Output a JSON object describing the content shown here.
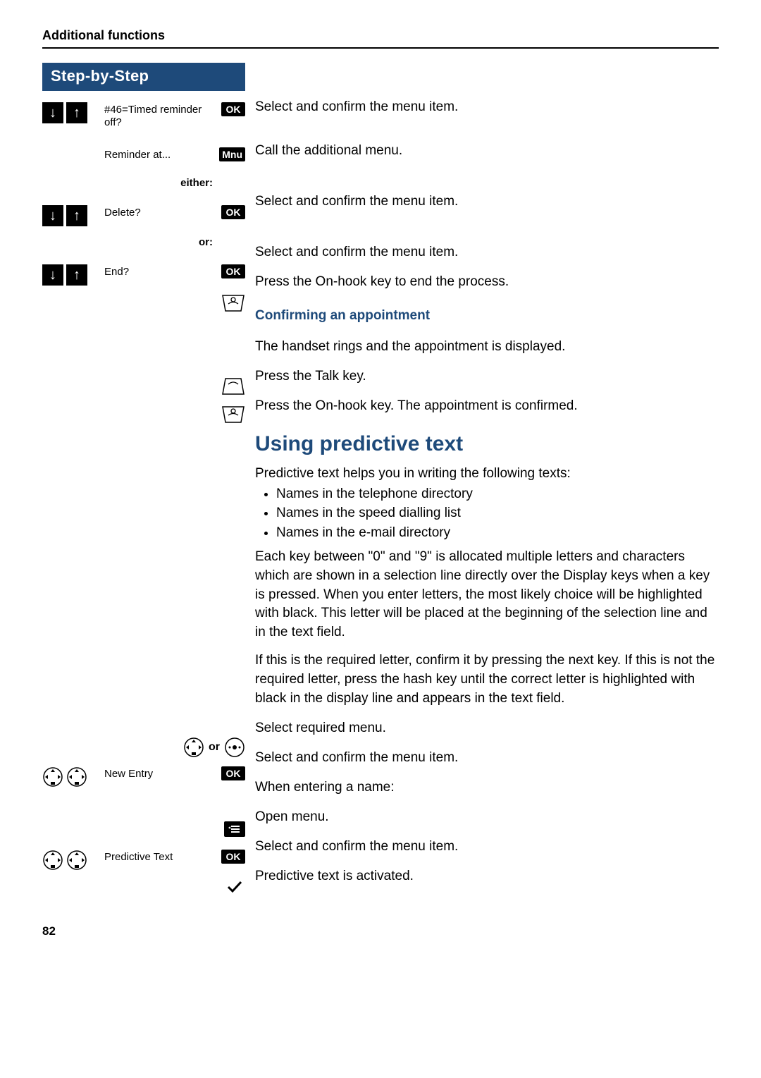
{
  "header": "Additional functions",
  "step_header": "Step-by-Step",
  "page_number": "82",
  "left": {
    "row1_label": "#46=Timed reminder off?",
    "row1_badge": "OK",
    "row2_label": "Reminder at...",
    "row2_badge": "Mnu",
    "either": "either:",
    "row3_label": "Delete?",
    "row3_badge": "OK",
    "or": "or:",
    "row4_label": "End?",
    "row4_badge": "OK",
    "nav_or": "or",
    "new_entry_label": "New Entry",
    "new_entry_badge": "OK",
    "predictive_label": "Predictive Text",
    "predictive_badge": "OK"
  },
  "right": {
    "r1": "Select and confirm the menu item.",
    "r2": "Call the additional menu.",
    "r3": "Select and confirm the menu item.",
    "r4": "Select and confirm the menu item.",
    "r5": "Press the On-hook key to end the process.",
    "confirm_heading": "Confirming an appointment",
    "r6": "The handset rings and the appointment is displayed.",
    "r7": "Press the Talk key.",
    "r8": "Press the On-hook key. The appointment is confirmed.",
    "predictive_heading": "Using predictive text",
    "p1": "Predictive text helps you in writing the following texts:",
    "b1": "Names in the telephone directory",
    "b2": "Names in the speed dialling list",
    "b3": "Names in the e-mail directory",
    "p2": "Each key between \"0\" and \"9\" is allocated multiple letters and characters which are shown in a selection line directly over the Display keys when a key is pressed. When you enter letters, the most likely choice will be highlighted with black. This letter will be placed at the beginning of the selection line and in the text field.",
    "p3": "If this is the required letter, confirm it by pressing the next key. If this is not the required letter, press the hash key until the correct letter is highlighted with black in the display line and appears in the text field.",
    "r9": "Select required menu.",
    "r10": "Select and confirm the menu item.",
    "r11": "When entering a name:",
    "r12": "Open menu.",
    "r13": "Select and confirm the menu item.",
    "r14": "Predictive text is activated."
  }
}
